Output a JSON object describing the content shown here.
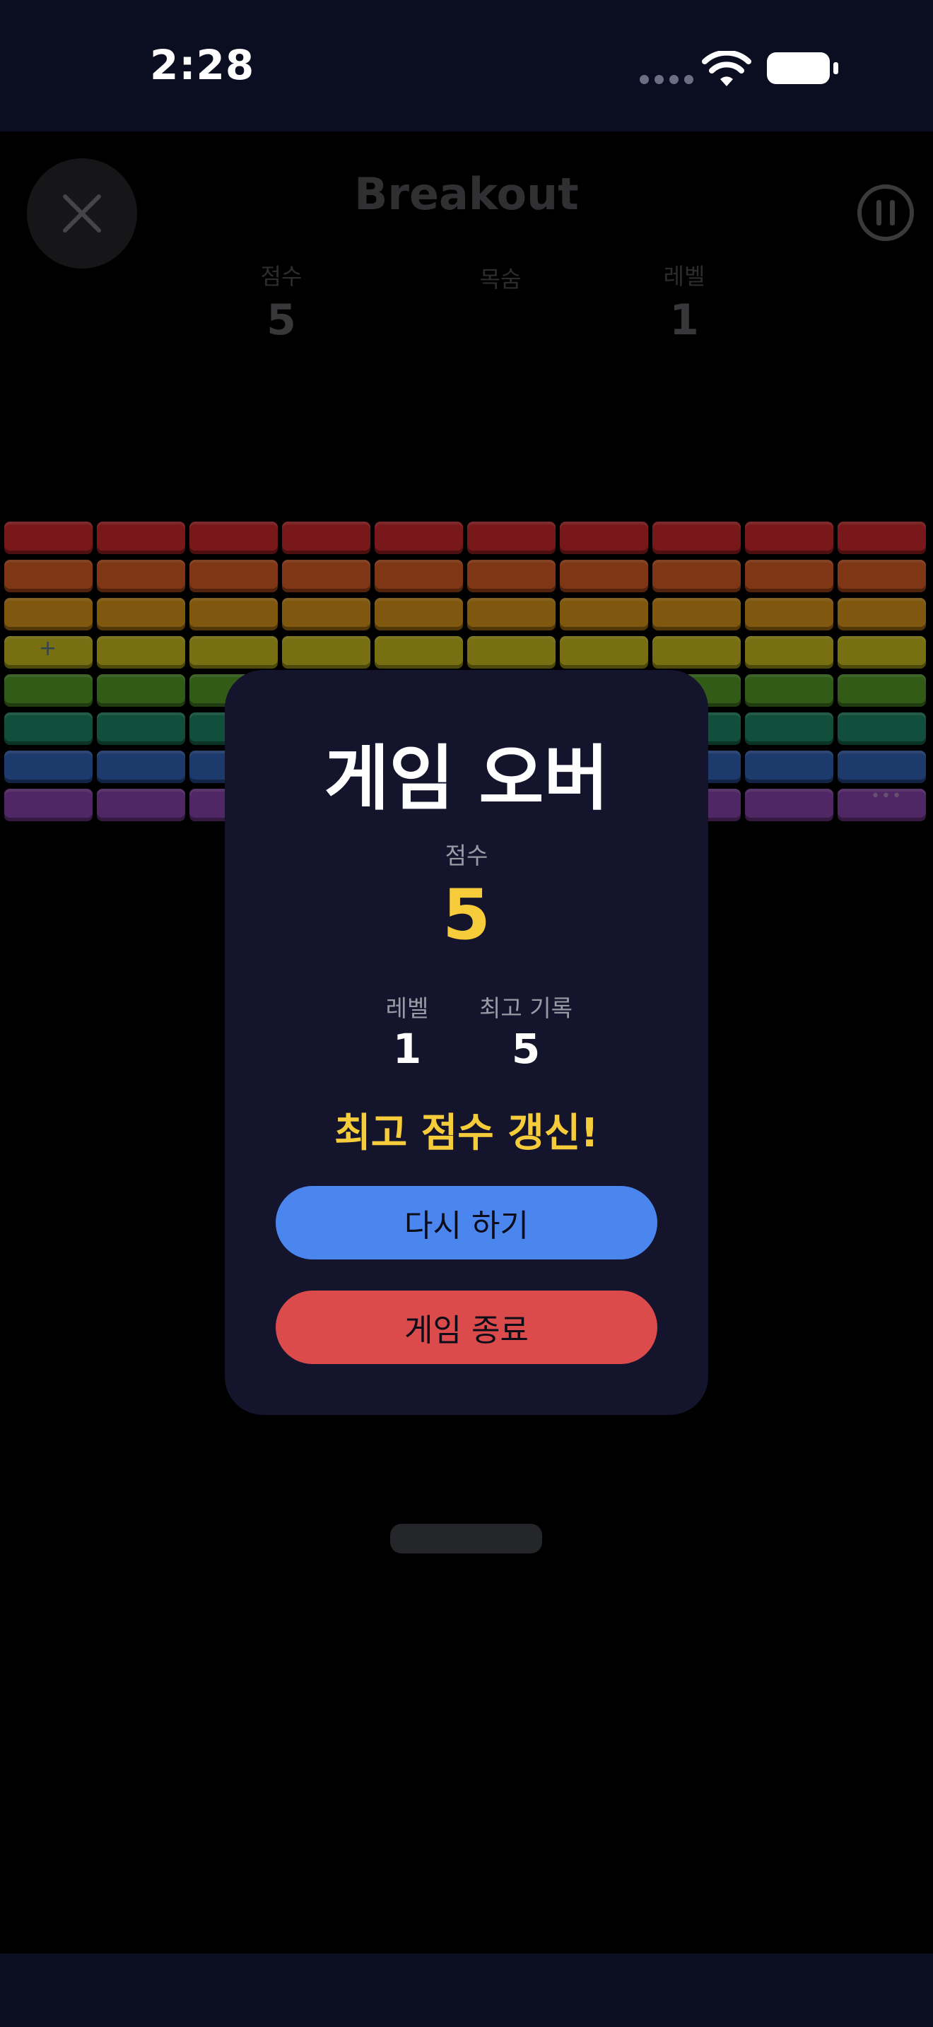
{
  "status_bar": {
    "time": "2:28",
    "signal_icon": "cellular-dots-icon",
    "wifi_icon": "wifi-icon",
    "battery_icon": "battery-icon"
  },
  "header": {
    "title": "Breakout",
    "close_icon": "close-icon",
    "pause_icon": "pause-icon",
    "stats": [
      {
        "label": "점수",
        "value": "5"
      },
      {
        "label": "목숨",
        "value": ""
      },
      {
        "label": "레벨",
        "value": "1"
      }
    ]
  },
  "bricks": {
    "columns": 10,
    "rows": [
      {
        "color": "#b8262a",
        "count": 10,
        "gap_start": 10
      },
      {
        "color": "#c2531f",
        "count": 10,
        "gap_start": 10
      },
      {
        "color": "#c48617",
        "count": 10,
        "gap_start": 10
      },
      {
        "color": "#b7ab1c",
        "count": 10,
        "gap_start": 10
      },
      {
        "color": "#4d8d26",
        "count": 10,
        "gap_start": 10
      },
      {
        "color": "#1b7a5c",
        "count": 10,
        "gap_start": 10
      },
      {
        "color": "#2c5aa6",
        "count": 10,
        "gap_start": 10
      },
      {
        "color": "#7b3d9b",
        "count": 10,
        "gap_start": 10
      }
    ],
    "powerups": [
      "plus-icon",
      "more-icon"
    ]
  },
  "paddle_icon": "paddle",
  "game_over": {
    "title": "게임 오버",
    "score_label": "점수",
    "score_value": "5",
    "level_label": "레벨",
    "level_value": "1",
    "best_label": "최고 기록",
    "best_value": "5",
    "new_record": "최고 점수 갱신!",
    "retry_label": "다시 하기",
    "quit_label": "게임 종료"
  },
  "colors": {
    "accent_yellow": "#f7cc3a",
    "retry_blue": "#4a86ee",
    "quit_red": "#db4b4c",
    "modal_bg": "#14142c"
  }
}
